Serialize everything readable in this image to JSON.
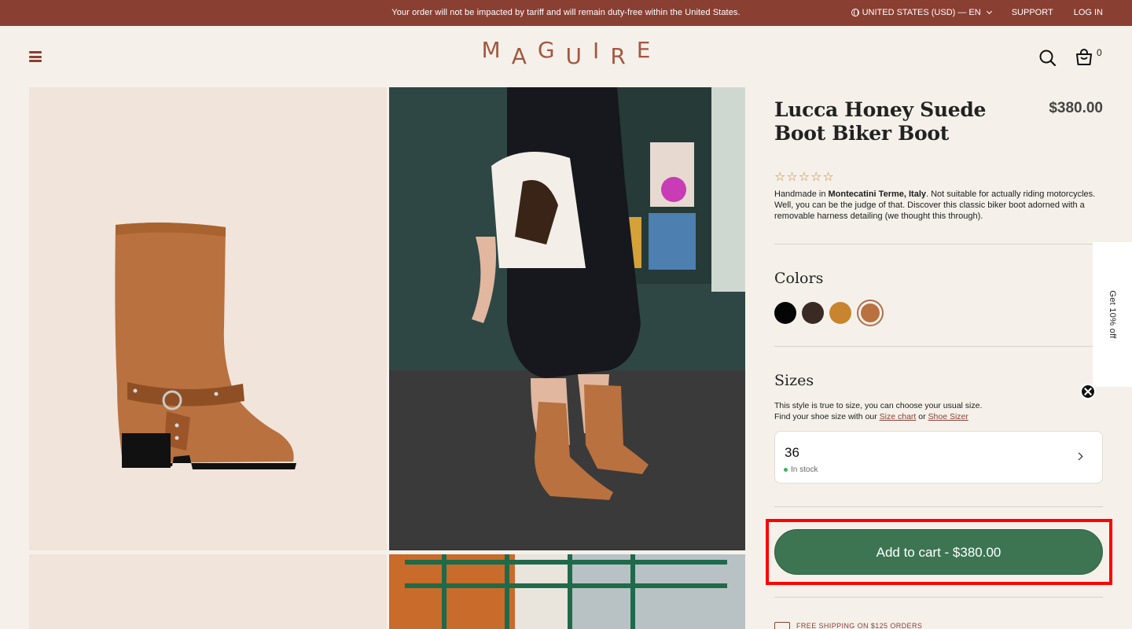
{
  "announcement": {
    "notice": "Your order will not be impacted by tariff and will remain duty-free within the United States.",
    "locale": "UNITED STATES (USD) — EN",
    "support": "SUPPORT",
    "login": "LOG IN"
  },
  "header": {
    "logo": [
      "M",
      "A",
      "G",
      "U",
      "I",
      "R",
      "E"
    ],
    "cart_count": "0"
  },
  "gallery": {
    "icons": [
      "boot-product-image",
      "model-lifestyle-image",
      "boot-detail-image",
      "lifestyle-image-2"
    ]
  },
  "product": {
    "title": "Lucca Honey Suede Boot Biker Boot",
    "price": "$380.00",
    "stars": [
      "☆",
      "☆",
      "☆",
      "☆",
      "☆"
    ],
    "desc_pre": "Handmade in ",
    "desc_bold": "Montecatini Terme, Italy",
    "desc_post": ". Not suitable for actually riding motorcycles. Well, you can be the judge of that. Discover this classic biker boot adorned with a removable harness detailing (we thought this through)."
  },
  "colors": {
    "label": "Colors",
    "swatches": [
      {
        "name": "black",
        "hex": "#050505"
      },
      {
        "name": "dark-brown",
        "hex": "#3a2a24"
      },
      {
        "name": "honey",
        "hex": "#c8842f"
      },
      {
        "name": "tan",
        "hex": "#b8713f"
      }
    ],
    "selected": "tan"
  },
  "sizes": {
    "label": "Sizes",
    "note_1": "This style is true to size, you can choose your usual size.",
    "note_2_pre": "Find your shoe size with our ",
    "size_chart": "Size chart",
    "or": " or ",
    "shoe_sizer": "Shoe Sizer",
    "selected_value": "36",
    "stock": "In stock"
  },
  "cart": {
    "label": "Add to cart - $380.00"
  },
  "shipping": {
    "text": "FREE SHIPPING ON $125 ORDERS"
  },
  "promo": {
    "tab": "Get 10% off"
  },
  "colors_theme": {
    "brand": "#8a3f33",
    "cta": "#3d7553",
    "background": "#f5f1ea"
  }
}
